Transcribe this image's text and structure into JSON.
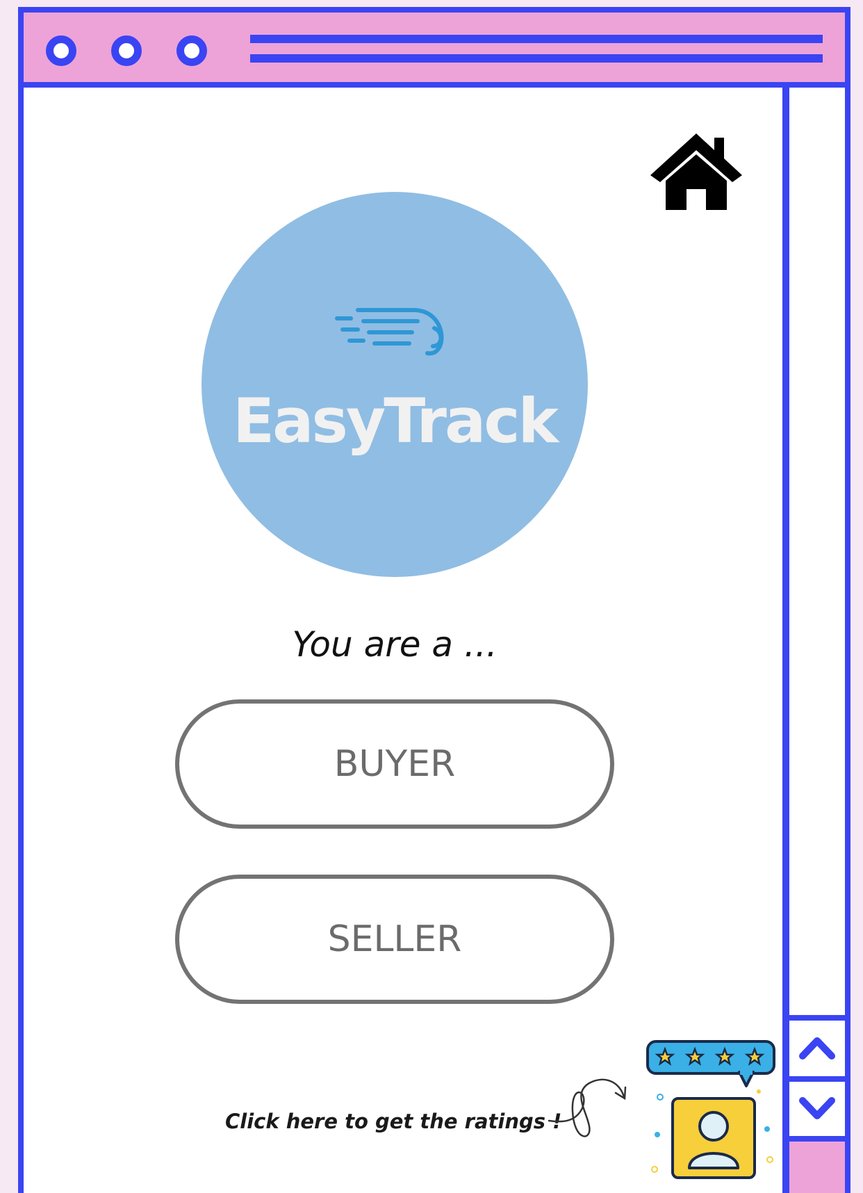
{
  "window": {
    "controls": [
      "window-dot",
      "window-dot",
      "window-dot"
    ]
  },
  "logo": {
    "text": "EasyTrack",
    "icon": "speed-lines-icon"
  },
  "home": {
    "icon": "home-icon"
  },
  "prompt": {
    "text": "You are a ..."
  },
  "roles": {
    "buyer_label": "BUYER",
    "seller_label": "SELLER"
  },
  "ratings": {
    "caption": "Click here to get the ratings !",
    "icon": "rating-profile-icon",
    "stars": 4
  },
  "colors": {
    "frame": "#3a44f2",
    "titlebar": "#eda3d8",
    "logo_circle": "#90bde3",
    "button_border": "#737373"
  }
}
